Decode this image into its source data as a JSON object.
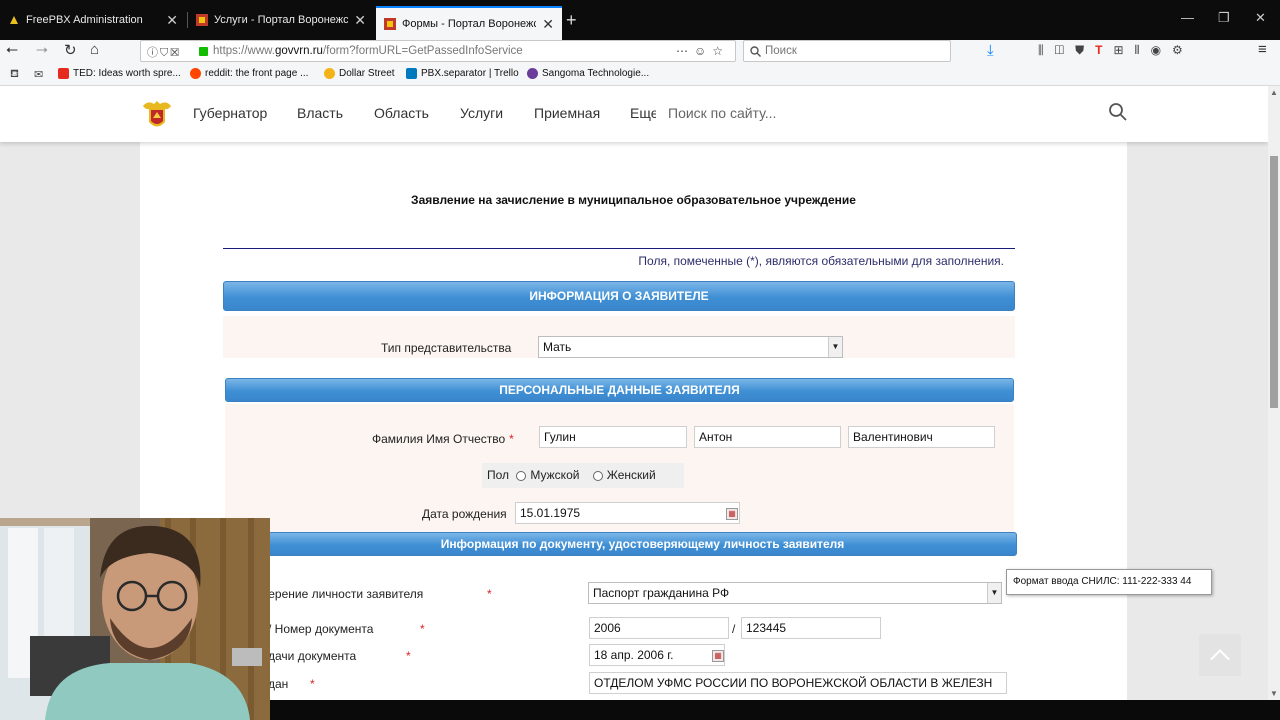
{
  "browser": {
    "tabs": [
      {
        "title": "FreePBX Administration",
        "active": false
      },
      {
        "title": "Услуги - Портал Воронежской",
        "active": false
      },
      {
        "title": "Формы - Портал Воронежской",
        "active": true
      }
    ],
    "url": {
      "prefix": "https://www.",
      "host": "govvrn.ru",
      "path": "/form?formURL=GetPassedInfoService"
    },
    "search_placeholder": "Поиск",
    "bookmarks": [
      {
        "label": "TED: Ideas worth spre...",
        "color": "#e62b1e"
      },
      {
        "label": "reddit: the front page ...",
        "color": "#ff4500"
      },
      {
        "label": "Dollar Street",
        "color": "#f5b31a"
      },
      {
        "label": "PBX.separator | Trello",
        "color": "#0079bf"
      },
      {
        "label": "Sangoma Technologie...",
        "color": "#6a3d9a"
      }
    ]
  },
  "site": {
    "menu": [
      "Губернатор",
      "Власть",
      "Область",
      "Услуги",
      "Приемная",
      "Еще"
    ],
    "search_placeholder": "Поиск по сайту..."
  },
  "form": {
    "title": "Заявление на зачисление в муниципальное образовательное учреждение",
    "required_note": "Поля, помеченные (*), являются обязательными для заполнения.",
    "required_mark": "*",
    "sections": {
      "applicant_info": "ИНФОРМАЦИЯ О ЗАЯВИТЕЛЕ",
      "personal_data": "ПЕРСОНАЛЬНЫЕ ДАННЫЕ ЗАЯВИТЕЛЯ",
      "document_info": "Информация по документу, удостоверяющему личность заявителя"
    },
    "representation": {
      "label": "Тип представительства",
      "value": "Мать"
    },
    "fio": {
      "label": "Фамилия Имя Отчество",
      "last": "Гулин",
      "first": "Антон",
      "middle": "Валентинович"
    },
    "gender": {
      "label": "Пол",
      "male": "Мужской",
      "female": "Женский"
    },
    "birth_date": {
      "label": "Дата рождения",
      "value": "15.01.1975"
    },
    "doc_type": {
      "label": "верение личности заявителя",
      "value": "Паспорт гражданина РФ"
    },
    "doc_number": {
      "label": "/ Номер документа",
      "series": "2006",
      "separator": "/",
      "number": "123445"
    },
    "doc_date": {
      "label": "дачи документа",
      "value": "18 апр. 2006 г."
    },
    "doc_issuer": {
      "label": "дан",
      "value": "ОТДЕЛОМ УФМС РОССИИ ПО ВОРОНЕЖСКОЙ ОБЛАСТИ В ЖЕЛЕЗН"
    }
  },
  "tooltip": "Формат ввода СНИЛС: 111-222-333 44"
}
